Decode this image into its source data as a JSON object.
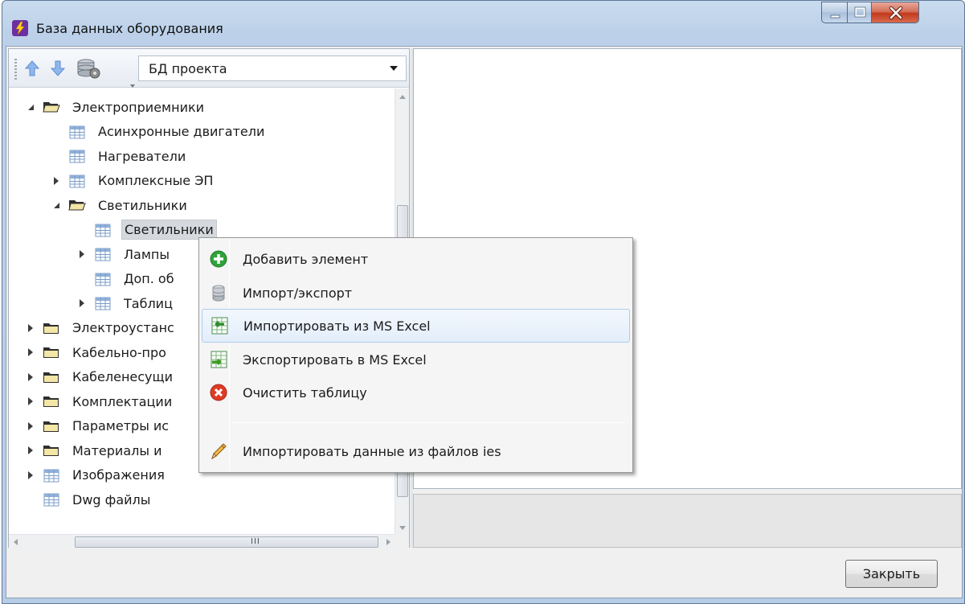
{
  "window": {
    "title": "База данных оборудования",
    "icon": "lightning-app-icon",
    "accent_color": "#c23a1d"
  },
  "toolbar": {
    "buttons": [
      {
        "name": "move-up-icon"
      },
      {
        "name": "move-down-icon"
      },
      {
        "name": "database-settings-icon"
      }
    ],
    "db_select_value": "БД проекта"
  },
  "tree": {
    "items": [
      {
        "label": "Электроприемники",
        "icon": "folder-open-icon",
        "state": "expanded"
      },
      {
        "label": "Асинхронные двигатели",
        "icon": "table-icon",
        "state": "leaf"
      },
      {
        "label": "Нагреватели",
        "icon": "table-icon",
        "state": "leaf"
      },
      {
        "label": "Комплексные ЭП",
        "icon": "table-icon",
        "state": "collapsed"
      },
      {
        "label": "Светильники",
        "icon": "folder-open-icon",
        "state": "expanded"
      },
      {
        "label": "Светильники",
        "icon": "table-icon",
        "state": "leaf",
        "selected": true
      },
      {
        "label": "Лампы",
        "icon": "table-icon",
        "state": "collapsed"
      },
      {
        "label": "Доп. об",
        "icon": "table-icon",
        "state": "leaf"
      },
      {
        "label": "Таблиц",
        "icon": "table-icon",
        "state": "collapsed"
      },
      {
        "label": "Электроустанс",
        "icon": "folder-icon",
        "state": "collapsed"
      },
      {
        "label": "Кабельно-про",
        "icon": "folder-icon",
        "state": "collapsed"
      },
      {
        "label": "Кабеленесущи",
        "icon": "folder-icon",
        "state": "collapsed"
      },
      {
        "label": "Комплектации",
        "icon": "folder-icon",
        "state": "collapsed"
      },
      {
        "label": "Параметры ис",
        "icon": "folder-icon",
        "state": "collapsed"
      },
      {
        "label": "Материалы и",
        "icon": "folder-icon",
        "state": "collapsed"
      },
      {
        "label": "Изображения",
        "icon": "table-icon",
        "state": "collapsed"
      },
      {
        "label": "Dwg файлы",
        "icon": "table-icon",
        "state": "leaf"
      }
    ],
    "hscroll_grip": "III"
  },
  "context_menu": {
    "items": [
      {
        "label": "Добавить элемент",
        "icon": "add-green-icon"
      },
      {
        "label": "Импорт/экспорт",
        "icon": "database-icon"
      },
      {
        "label": "Импортировать из MS Excel",
        "icon": "excel-import-icon",
        "hover": true
      },
      {
        "label": "Экспортировать в MS Excel",
        "icon": "excel-export-icon"
      },
      {
        "label": "Очистить таблицу",
        "icon": "clear-red-icon"
      },
      {
        "label": "Импортировать данные из файлов ies",
        "icon": "pencil-icon"
      }
    ]
  },
  "footer": {
    "close_label": "Закрыть"
  }
}
